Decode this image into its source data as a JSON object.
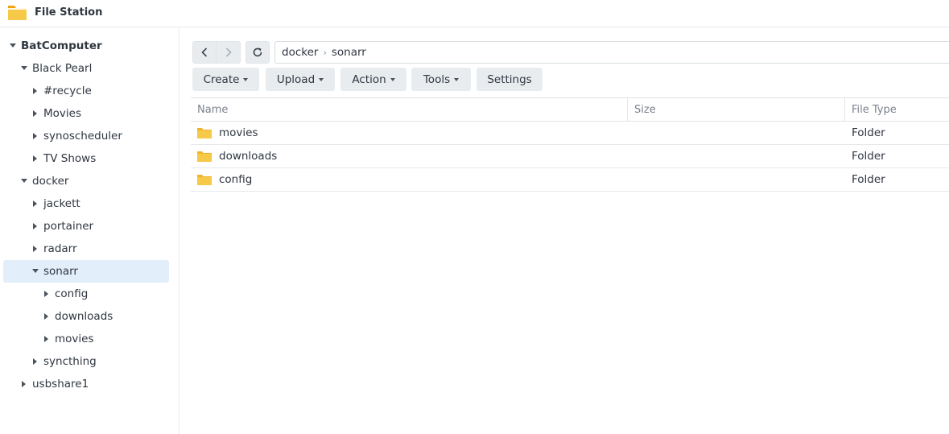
{
  "app": {
    "title": "File Station",
    "icon": "file-station-folder-icon"
  },
  "sidebar": {
    "items": [
      {
        "label": "BatComputer",
        "expanded": true
      },
      {
        "label": "Black Pearl",
        "expanded": true
      },
      {
        "label": "#recycle",
        "expanded": false
      },
      {
        "label": "Movies",
        "expanded": false
      },
      {
        "label": "synoscheduler",
        "expanded": false
      },
      {
        "label": "TV Shows",
        "expanded": false
      },
      {
        "label": "docker",
        "expanded": true
      },
      {
        "label": "jackett",
        "expanded": false
      },
      {
        "label": "portainer",
        "expanded": false
      },
      {
        "label": "radarr",
        "expanded": false
      },
      {
        "label": "sonarr",
        "expanded": true,
        "selected": true
      },
      {
        "label": "config",
        "expanded": false
      },
      {
        "label": "downloads",
        "expanded": false
      },
      {
        "label": "movies",
        "expanded": false
      },
      {
        "label": "syncthing",
        "expanded": false
      },
      {
        "label": "usbshare1",
        "expanded": false
      }
    ]
  },
  "path": {
    "crumbs": [
      "docker",
      "sonarr"
    ]
  },
  "toolbar": {
    "create": "Create",
    "upload": "Upload",
    "action": "Action",
    "tools": "Tools",
    "settings": "Settings"
  },
  "table": {
    "columns": [
      "Name",
      "Size",
      "File Type"
    ],
    "rows": [
      {
        "name": "movies",
        "size": "",
        "type": "Folder"
      },
      {
        "name": "downloads",
        "size": "",
        "type": "Folder"
      },
      {
        "name": "config",
        "size": "",
        "type": "Folder"
      }
    ]
  },
  "colors": {
    "selected": "#e3eefb",
    "folder": "#f7c948",
    "button": "#e9ecef"
  }
}
